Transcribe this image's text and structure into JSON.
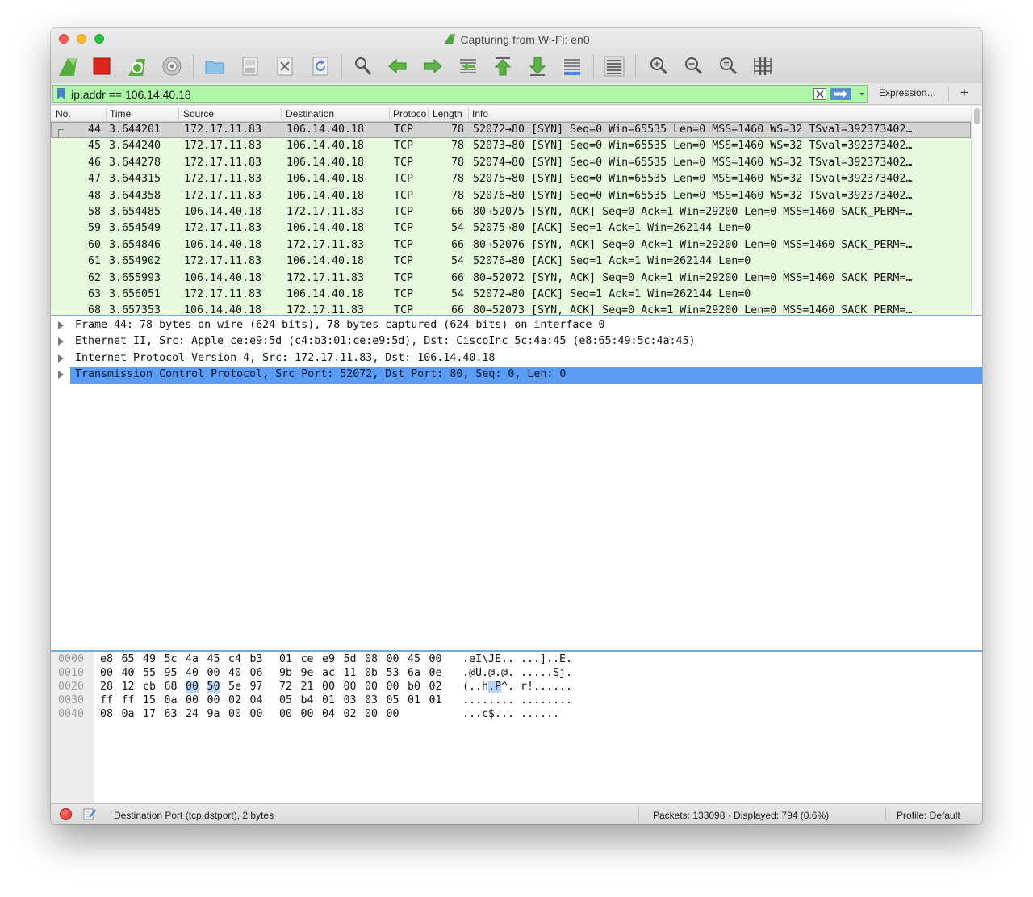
{
  "window": {
    "title": "Capturing from Wi-Fi: en0",
    "colors": {
      "filter_valid": "#aff8a9",
      "row_tcp": "#e7f9dc",
      "selection": "#5b9cf4",
      "stop": "#e0251b"
    }
  },
  "toolbar": {
    "buttons": [
      "start-capture-icon",
      "stop-capture-icon",
      "restart-capture-icon",
      "capture-options-icon",
      "open-file-icon",
      "save-file-icon",
      "close-file-icon",
      "reload-file-icon",
      "find-packet-icon",
      "go-back-icon",
      "go-forward-icon",
      "go-to-packet-icon",
      "first-packet-icon",
      "last-packet-icon",
      "auto-scroll-icon",
      "colorize-icon",
      "zoom-in-icon",
      "zoom-out-icon",
      "zoom-normal-icon",
      "resize-columns-icon"
    ]
  },
  "filter": {
    "value": "ip.addr == 106.14.40.18",
    "expression_label": "Expression…",
    "add_label": "+"
  },
  "packet_list": {
    "columns": [
      "No.",
      "Time",
      "Source",
      "Destination",
      "Protocol",
      "Length",
      "Info"
    ],
    "rows": [
      {
        "no": "44",
        "time": "3.644201",
        "src": "172.17.11.83",
        "dst": "106.14.40.18",
        "proto": "TCP",
        "len": "78",
        "info": "52072→80 [SYN] Seq=0 Win=65535 Len=0 MSS=1460 WS=32 TSval=392373402…"
      },
      {
        "no": "45",
        "time": "3.644240",
        "src": "172.17.11.83",
        "dst": "106.14.40.18",
        "proto": "TCP",
        "len": "78",
        "info": "52073→80 [SYN] Seq=0 Win=65535 Len=0 MSS=1460 WS=32 TSval=392373402…"
      },
      {
        "no": "46",
        "time": "3.644278",
        "src": "172.17.11.83",
        "dst": "106.14.40.18",
        "proto": "TCP",
        "len": "78",
        "info": "52074→80 [SYN] Seq=0 Win=65535 Len=0 MSS=1460 WS=32 TSval=392373402…"
      },
      {
        "no": "47",
        "time": "3.644315",
        "src": "172.17.11.83",
        "dst": "106.14.40.18",
        "proto": "TCP",
        "len": "78",
        "info": "52075→80 [SYN] Seq=0 Win=65535 Len=0 MSS=1460 WS=32 TSval=392373402…"
      },
      {
        "no": "48",
        "time": "3.644358",
        "src": "172.17.11.83",
        "dst": "106.14.40.18",
        "proto": "TCP",
        "len": "78",
        "info": "52076→80 [SYN] Seq=0 Win=65535 Len=0 MSS=1460 WS=32 TSval=392373402…"
      },
      {
        "no": "58",
        "time": "3.654485",
        "src": "106.14.40.18",
        "dst": "172.17.11.83",
        "proto": "TCP",
        "len": "66",
        "info": "80→52075 [SYN, ACK] Seq=0 Ack=1 Win=29200 Len=0 MSS=1460 SACK_PERM=…"
      },
      {
        "no": "59",
        "time": "3.654549",
        "src": "172.17.11.83",
        "dst": "106.14.40.18",
        "proto": "TCP",
        "len": "54",
        "info": "52075→80 [ACK] Seq=1 Ack=1 Win=262144 Len=0"
      },
      {
        "no": "60",
        "time": "3.654846",
        "src": "106.14.40.18",
        "dst": "172.17.11.83",
        "proto": "TCP",
        "len": "66",
        "info": "80→52076 [SYN, ACK] Seq=0 Ack=1 Win=29200 Len=0 MSS=1460 SACK_PERM=…"
      },
      {
        "no": "61",
        "time": "3.654902",
        "src": "172.17.11.83",
        "dst": "106.14.40.18",
        "proto": "TCP",
        "len": "54",
        "info": "52076→80 [ACK] Seq=1 Ack=1 Win=262144 Len=0"
      },
      {
        "no": "62",
        "time": "3.655993",
        "src": "106.14.40.18",
        "dst": "172.17.11.83",
        "proto": "TCP",
        "len": "66",
        "info": "80→52072 [SYN, ACK] Seq=0 Ack=1 Win=29200 Len=0 MSS=1460 SACK_PERM=…"
      },
      {
        "no": "63",
        "time": "3.656051",
        "src": "172.17.11.83",
        "dst": "106.14.40.18",
        "proto": "TCP",
        "len": "54",
        "info": "52072→80 [ACK] Seq=1 Ack=1 Win=262144 Len=0"
      },
      {
        "no": "68",
        "time": "3.657353",
        "src": "106.14.40.18",
        "dst": "172.17.11.83",
        "proto": "TCP",
        "len": "66",
        "info": "80→52073 [SYN, ACK] Seq=0 Ack=1 Win=29200 Len=0 MSS=1460 SACK_PERM=…"
      }
    ]
  },
  "packet_details": [
    "Frame 44: 78 bytes on wire (624 bits), 78 bytes captured (624 bits) on interface 0",
    "Ethernet II, Src: Apple_ce:e9:5d (c4:b3:01:ce:e9:5d), Dst: CiscoInc_5c:4a:45 (e8:65:49:5c:4a:45)",
    "Internet Protocol Version 4, Src: 172.17.11.83, Dst: 106.14.40.18",
    "Transmission Control Protocol, Src Port: 52072, Dst Port: 80, Seq: 0, Len: 0"
  ],
  "packet_bytes": [
    {
      "offset": "0000",
      "hex": [
        "e8",
        "65",
        "49",
        "5c",
        "4a",
        "45",
        "c4",
        "b3",
        "01",
        "ce",
        "e9",
        "5d",
        "08",
        "00",
        "45",
        "00"
      ],
      "ascii": ".eI\\JE.. ...]..E."
    },
    {
      "offset": "0010",
      "hex": [
        "00",
        "40",
        "55",
        "95",
        "40",
        "00",
        "40",
        "06",
        "9b",
        "9e",
        "ac",
        "11",
        "0b",
        "53",
        "6a",
        "0e"
      ],
      "ascii": ".@U.@.@. .....Sj."
    },
    {
      "offset": "0020",
      "hex": [
        "28",
        "12",
        "cb",
        "68",
        "00",
        "50",
        "5e",
        "97",
        "72",
        "21",
        "00",
        "00",
        "00",
        "00",
        "b0",
        "02"
      ],
      "ascii": "(..h.P^. r!......"
    },
    {
      "offset": "0030",
      "hex": [
        "ff",
        "ff",
        "15",
        "0a",
        "00",
        "00",
        "02",
        "04",
        "05",
        "b4",
        "01",
        "03",
        "03",
        "05",
        "01",
        "01"
      ],
      "ascii": "........ ........"
    },
    {
      "offset": "0040",
      "hex": [
        "08",
        "0a",
        "17",
        "63",
        "24",
        "9a",
        "00",
        "00",
        "00",
        "00",
        "04",
        "02",
        "00",
        "00"
      ],
      "ascii": "...c$... ......"
    }
  ],
  "status": {
    "field_info": "Destination Port (tcp.dstport), 2 bytes",
    "packets": "Packets: 133098 · Displayed: 794 (0.6%)",
    "profile": "Profile: Default"
  }
}
